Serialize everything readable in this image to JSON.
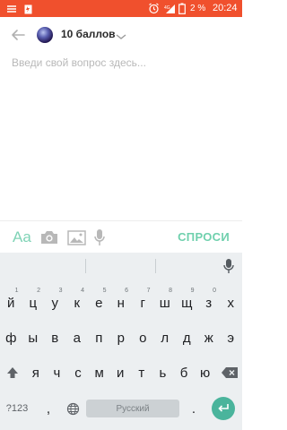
{
  "status_bar": {
    "battery_text": "2 %",
    "time": "20:24",
    "accent": "#f0502d"
  },
  "header": {
    "points_label": "10 баллов"
  },
  "question": {
    "placeholder": "Введи свой вопрос здесь..."
  },
  "toolbar": {
    "font_label": "Aa",
    "submit_label": "СПРОСИ",
    "accent": "#6fd0ad"
  },
  "keyboard": {
    "row1": [
      {
        "key": "й",
        "hint": "1"
      },
      {
        "key": "ц",
        "hint": "2"
      },
      {
        "key": "у",
        "hint": "3"
      },
      {
        "key": "к",
        "hint": "4"
      },
      {
        "key": "е",
        "hint": "5"
      },
      {
        "key": "н",
        "hint": "6"
      },
      {
        "key": "г",
        "hint": "7"
      },
      {
        "key": "ш",
        "hint": "8"
      },
      {
        "key": "щ",
        "hint": "9"
      },
      {
        "key": "з",
        "hint": "0"
      },
      {
        "key": "х",
        "hint": ""
      }
    ],
    "row2": [
      "ф",
      "ы",
      "в",
      "а",
      "п",
      "р",
      "о",
      "л",
      "д",
      "ж",
      "э"
    ],
    "row3": [
      "я",
      "ч",
      "с",
      "м",
      "и",
      "т",
      "ь",
      "б",
      "ю"
    ],
    "symbols_label": "?123",
    "comma_label": ",",
    "space_label": "Русский",
    "period_label": ".",
    "icons": [
      "shift-icon",
      "backspace-icon",
      "globe-icon",
      "enter-icon",
      "microphone-icon"
    ]
  }
}
